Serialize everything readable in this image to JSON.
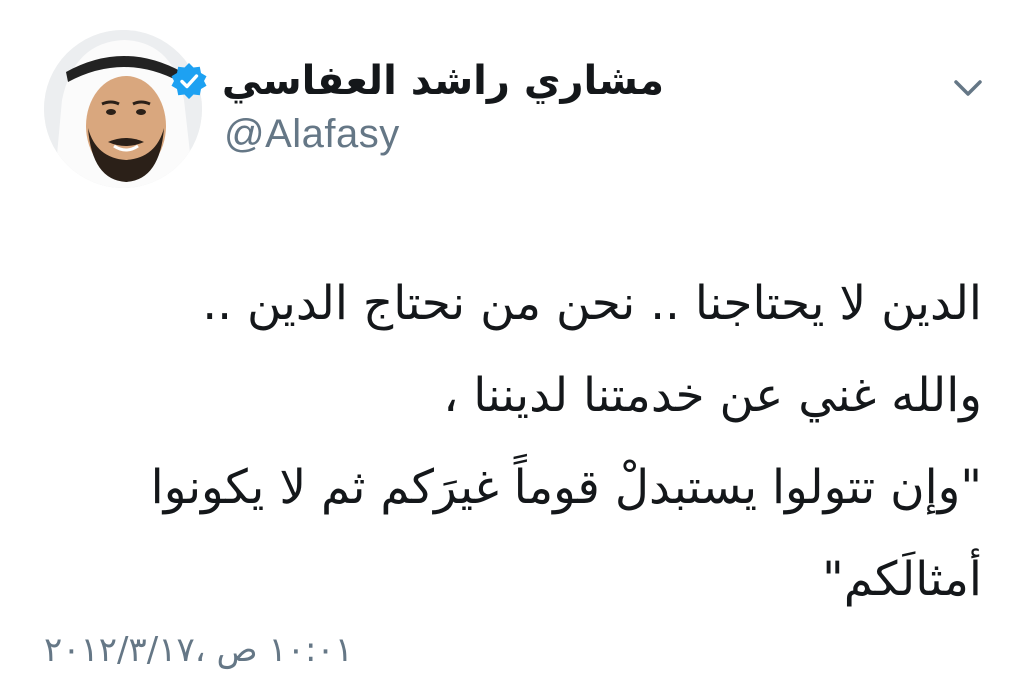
{
  "tweet": {
    "author": {
      "display_name": "مشاري راشد العفاسي",
      "handle": "@Alafasy",
      "verified": true,
      "verified_icon": "verified-badge-icon",
      "avatar_icon": "profile-photo"
    },
    "menu_icon": "chevron-down-icon",
    "body_lines": [
      "الدين لا يحتاجنا .. نحن من نحتاج الدين ..",
      "والله غني عن خدمتنا لديننا ،",
      "\"وإن تتولوا يستبدلْ قوماً غيرَكم ثم لا يكونوا",
      "أمثالَكم\""
    ],
    "timestamp": "١٠:٠١ ص ،٢٠١٢/٣/١٧"
  },
  "colors": {
    "text_primary": "#14171a",
    "text_secondary": "#657786",
    "verified_blue": "#1da1f2",
    "background": "#ffffff"
  }
}
